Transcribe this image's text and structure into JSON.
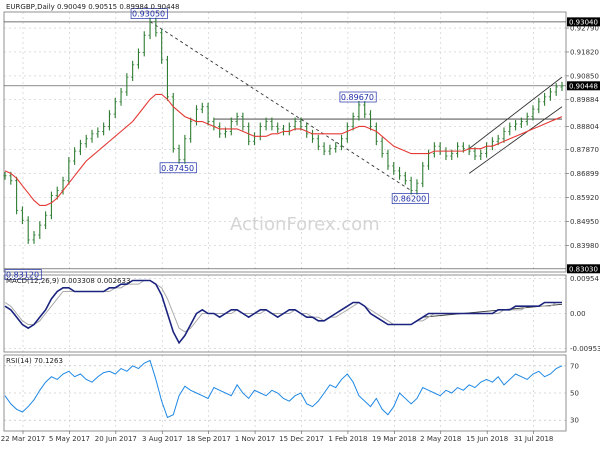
{
  "header": {
    "text": "EURGBP,Daily  0.90049 0.90515 0.89984 0.90448"
  },
  "watermark": "ActionForex.com",
  "colors": {
    "price": "#2e7d32",
    "ma": "#e53935",
    "macd": "#1a237e",
    "signal": "#aaaaaa",
    "rsi": "#1e88e5",
    "annotation": "#1f2fa8",
    "trend": "#333333",
    "tag_bg": "#000000"
  },
  "chart_data": [
    {
      "type": "line",
      "name": "price",
      "title": "EURGBP,Daily  0.90049 0.90515 0.89984 0.90448",
      "x_labels": [
        "22 Mar 2017",
        "5 May 2017",
        "20 Jun 2017",
        "3 Aug 2017",
        "18 Sep 2017",
        "1 Nov 2017",
        "15 Dec 2017",
        "1 Feb 2018",
        "19 Mar 2018",
        "2 May 2018",
        "15 Jun 2018",
        "31 Jul 2018"
      ],
      "y_ticks": [
        0.9279,
        0.9182,
        0.9085,
        0.89884,
        0.88804,
        0.8787,
        0.86899,
        0.8592,
        0.8495,
        0.8398
      ],
      "ylim": [
        0.829,
        0.9344
      ],
      "key_levels": [
        "0.93040",
        "0.90448",
        "0.83030"
      ],
      "series": [
        {
          "kind": "close",
          "values": [
            0.868,
            0.866,
            0.854,
            0.85,
            0.842,
            0.844,
            0.848,
            0.852,
            0.86,
            0.862,
            0.866,
            0.874,
            0.878,
            0.881,
            0.883,
            0.885,
            0.886,
            0.888,
            0.893,
            0.898,
            0.902,
            0.908,
            0.913,
            0.918,
            0.925,
            0.9305,
            0.926,
            0.915,
            0.9,
            0.879,
            0.8745,
            0.883,
            0.89,
            0.895,
            0.896,
            0.89,
            0.888,
            0.885,
            0.886,
            0.89,
            0.892,
            0.888,
            0.882,
            0.884,
            0.888,
            0.89,
            0.888,
            0.887,
            0.886,
            0.888,
            0.89,
            0.888,
            0.885,
            0.883,
            0.88,
            0.878,
            0.879,
            0.88,
            0.883,
            0.888,
            0.892,
            0.8967,
            0.893,
            0.888,
            0.882,
            0.877,
            0.872,
            0.87,
            0.868,
            0.866,
            0.862,
            0.865,
            0.872,
            0.877,
            0.88,
            0.878,
            0.876,
            0.877,
            0.88,
            0.879,
            0.878,
            0.876,
            0.877,
            0.88,
            0.882,
            0.883,
            0.886,
            0.888,
            0.889,
            0.89,
            0.892,
            0.895,
            0.898,
            0.9,
            0.902,
            0.904,
            0.9045
          ]
        },
        {
          "kind": "moving_average",
          "values": [
            0.87,
            0.869,
            0.867,
            0.864,
            0.861,
            0.858,
            0.856,
            0.856,
            0.857,
            0.859,
            0.862,
            0.865,
            0.868,
            0.871,
            0.874,
            0.876,
            0.878,
            0.88,
            0.882,
            0.884,
            0.886,
            0.888,
            0.89,
            0.893,
            0.896,
            0.899,
            0.901,
            0.901,
            0.899,
            0.896,
            0.894,
            0.892,
            0.891,
            0.89,
            0.89,
            0.889,
            0.888,
            0.887,
            0.887,
            0.887,
            0.887,
            0.886,
            0.885,
            0.884,
            0.884,
            0.884,
            0.885,
            0.885,
            0.886,
            0.886,
            0.887,
            0.887,
            0.886,
            0.885,
            0.885,
            0.885,
            0.885,
            0.885,
            0.885,
            0.886,
            0.887,
            0.888,
            0.888,
            0.887,
            0.886,
            0.884,
            0.882,
            0.88,
            0.879,
            0.878,
            0.877,
            0.877,
            0.877,
            0.877,
            0.878,
            0.878,
            0.878,
            0.878,
            0.878,
            0.878,
            0.879,
            0.879,
            0.879,
            0.88,
            0.88,
            0.881,
            0.882,
            0.883,
            0.884,
            0.885,
            0.886,
            0.887,
            0.888,
            0.889,
            0.89,
            0.891,
            0.892
          ]
        }
      ],
      "annotations": [
        {
          "text": "0.93050",
          "value": 0.9305,
          "index": 25
        },
        {
          "text": "0.87450",
          "value": 0.8745,
          "index": 30
        },
        {
          "text": "0.89670",
          "value": 0.8967,
          "index": 61
        },
        {
          "text": "0.86200",
          "value": 0.862,
          "index": 70
        },
        {
          "text": "0.83120",
          "value": 0.8312,
          "index": 0
        }
      ],
      "trendlines": [
        {
          "style": "dashed",
          "from": [
            25,
            0.9305
          ],
          "to": [
            70,
            0.862
          ]
        },
        {
          "style": "solid",
          "from": [
            36,
            0.891
          ],
          "to": [
            96,
            0.891
          ]
        },
        {
          "style": "solid",
          "from": [
            80,
            0.879
          ],
          "to": [
            96,
            0.908
          ]
        },
        {
          "style": "solid",
          "from": [
            80,
            0.869
          ],
          "to": [
            96,
            0.896
          ]
        }
      ]
    },
    {
      "type": "line",
      "name": "macd",
      "title": "MACD(12,26,9) 0.003308 0.002633",
      "y_ticks": [
        "0.00954",
        "0.00",
        "-0.009538"
      ],
      "ylim": [
        -0.0105,
        0.0105
      ],
      "series": [
        {
          "kind": "macd",
          "values": [
            0.002,
            0.001,
            -0.001,
            -0.003,
            -0.004,
            -0.003,
            -0.001,
            0.001,
            0.004,
            0.006,
            0.007,
            0.007,
            0.006,
            0.006,
            0.006,
            0.006,
            0.006,
            0.006,
            0.007,
            0.007,
            0.008,
            0.008,
            0.009,
            0.009,
            0.009,
            0.009,
            0.008,
            0.005,
            0.0,
            -0.005,
            -0.008,
            -0.006,
            -0.003,
            0.0,
            0.001,
            0.0,
            0.0,
            -0.001,
            0.0,
            0.001,
            0.001,
            0.0,
            -0.001,
            0.0,
            0.001,
            0.001,
            0.0,
            -0.001,
            0.0,
            0.001,
            0.001,
            0.0,
            -0.001,
            -0.001,
            -0.002,
            -0.002,
            -0.001,
            0.0,
            0.001,
            0.002,
            0.003,
            0.003,
            0.002,
            0.0,
            -0.001,
            -0.002,
            -0.003,
            -0.003,
            -0.003,
            -0.003,
            -0.003,
            -0.002,
            -0.001,
            0.0,
            0.0,
            0.0,
            0.0,
            0.0,
            0.0,
            0.0,
            0.0,
            0.0,
            0.0,
            0.0,
            0.0,
            0.001,
            0.001,
            0.001,
            0.002,
            0.002,
            0.002,
            0.002,
            0.002,
            0.003,
            0.003,
            0.003,
            0.003
          ]
        },
        {
          "kind": "signal",
          "values": [
            0.003,
            0.002,
            0.0,
            -0.002,
            -0.003,
            -0.003,
            -0.002,
            0.0,
            0.002,
            0.004,
            0.006,
            0.006,
            0.006,
            0.006,
            0.006,
            0.006,
            0.006,
            0.006,
            0.006,
            0.007,
            0.007,
            0.008,
            0.008,
            0.008,
            0.009,
            0.009,
            0.008,
            0.007,
            0.004,
            0.0,
            -0.004,
            -0.005,
            -0.004,
            -0.002,
            0.0,
            0.0,
            0.0,
            0.0,
            0.0,
            0.0,
            0.001,
            0.0,
            0.0,
            0.0,
            0.0,
            0.001,
            0.0,
            0.0,
            0.0,
            0.0,
            0.001,
            0.0,
            0.0,
            -0.001,
            -0.001,
            -0.002,
            -0.001,
            -0.001,
            0.0,
            0.001,
            0.002,
            0.003,
            0.002,
            0.001,
            0.0,
            -0.001,
            -0.002,
            -0.003,
            -0.003,
            -0.003,
            -0.003,
            -0.002,
            -0.002,
            -0.001,
            0.0,
            0.0,
            0.0,
            0.0,
            0.0,
            0.0,
            0.0,
            0.0,
            0.0,
            0.0,
            0.0,
            0.0,
            0.001,
            0.001,
            0.001,
            0.001,
            0.002,
            0.002,
            0.002,
            0.002,
            0.002,
            0.003,
            0.003
          ]
        }
      ],
      "trendline": {
        "from": [
          72,
          -0.001
        ],
        "to": [
          96,
          0.0025
        ]
      }
    },
    {
      "type": "line",
      "name": "rsi",
      "title": "RSI(14) 70.1263",
      "y_ticks": [
        "70",
        "50",
        "30"
      ],
      "ylim": [
        22,
        78
      ],
      "series": [
        {
          "kind": "rsi",
          "values": [
            48,
            42,
            38,
            36,
            40,
            45,
            52,
            58,
            62,
            60,
            64,
            66,
            62,
            64,
            60,
            58,
            62,
            65,
            66,
            64,
            68,
            66,
            70,
            68,
            72,
            74,
            60,
            44,
            32,
            34,
            48,
            55,
            52,
            50,
            48,
            46,
            54,
            52,
            50,
            48,
            56,
            50,
            46,
            52,
            50,
            48,
            52,
            50,
            46,
            44,
            48,
            50,
            42,
            40,
            44,
            50,
            56,
            54,
            60,
            64,
            58,
            48,
            44,
            40,
            46,
            38,
            34,
            40,
            50,
            46,
            42,
            46,
            54,
            52,
            50,
            48,
            52,
            50,
            54,
            52,
            56,
            54,
            58,
            60,
            58,
            62,
            56,
            60,
            64,
            62,
            60,
            64,
            66,
            62,
            64,
            68,
            70
          ]
        }
      ]
    }
  ]
}
